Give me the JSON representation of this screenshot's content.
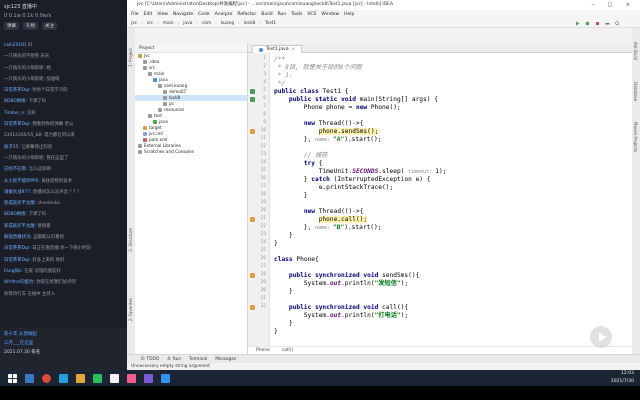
{
  "chat": {
    "header_line1": "sjc123 直播中",
    "header_line2": "0  0.1w  0.1k  0.0w/s",
    "header_buttons": [
      "弹幕",
      "礼物",
      "关注"
    ],
    "messages": [
      {
        "user": "cwh20181",
        "text": "好"
      },
      {
        "user": "",
        "text": "一只快乐的不想卷 乐乐"
      },
      {
        "user": "",
        "text": "一只快乐的小萌新呢: 她"
      },
      {
        "user": "",
        "text": "一只快乐的小萌新呢: 加油呀"
      },
      {
        "user": "日常茶茶Dqr:",
        "text": "秒杀个日常学习的"
      },
      {
        "user": "BOBO网络:",
        "text": "下课了吗"
      },
      {
        "user": "Timber_x:",
        "text": "没有"
      },
      {
        "user": "日常茶茶Dqr:",
        "text": "我看到你的弹幕 老公"
      },
      {
        "user": "",
        "text": "23414266/55_b8: 电力都在何以来"
      },
      {
        "user": "疯子25:",
        "text": "让屏幕停止的话"
      },
      {
        "user": "",
        "text": "一只快乐的小萌新呢: 我在这里了"
      },
      {
        "user": "已经不在哦:",
        "text": "怎么这样啊"
      },
      {
        "user": "从小就不能听PPS:",
        "text": "再往前移的技术"
      },
      {
        "user": "请做大战977:",
        "text": "直播间怎么没声音 ? ? ?"
      },
      {
        "user": "新成就买不太醒:",
        "text": "zhenbinko"
      },
      {
        "user": "BOBO网络:",
        "text": "下课了吗"
      },
      {
        "user": "新成就买不太醒:",
        "text": "继续看"
      },
      {
        "user": "解锁直播状况:",
        "text": "这都能认识看的"
      },
      {
        "user": "日常茶茶Dqr:",
        "text": "日正在看直播 你一下两小时前"
      },
      {
        "user": "日常茶茶Dqr:",
        "text": "好多上来的 你好"
      },
      {
        "user": "Fang骑x:",
        "text": "在家 没钱的朋友好"
      },
      {
        "user": "Wh尔cs的配为:",
        "text": "你现在给我们加点吧"
      },
      {
        "user": "",
        "text": "你等待行车 在线中 主持人"
      }
    ],
    "footer_lines": [
      "新十年 从我做起",
      "三月___在这里",
      "2021.07.30 排名"
    ]
  },
  "ide": {
    "title": "jvc [C:\\Users\\Administrator\\Desktop\\并发编程\\jvc] - ...\\src\\main\\java\\com\\kuang\\lock8\\Test1.java [jvc] - IntelliJ IDEA",
    "menu": [
      "File",
      "Edit",
      "View",
      "Navigate",
      "Code",
      "Analyze",
      "Refactor",
      "Build",
      "Run",
      "Tools",
      "VCS",
      "Window",
      "Help"
    ],
    "breadcrumbs": [
      "jvc",
      "src",
      "main",
      "java",
      "com",
      "kuang",
      "lock8",
      "Test1"
    ],
    "project_header": "Project",
    "tree": [
      {
        "label": "jvc",
        "depth": 0,
        "color": "#c7a34a",
        "selected": false
      },
      {
        "label": ".idea",
        "depth": 1,
        "color": "#9a9a9a",
        "selected": false
      },
      {
        "label": "src",
        "depth": 1,
        "color": "#9a9a9a",
        "selected": false
      },
      {
        "label": "main",
        "depth": 2,
        "color": "#9a9a9a",
        "selected": false
      },
      {
        "label": "java",
        "depth": 3,
        "color": "#4a8ed8",
        "selected": false
      },
      {
        "label": "com.kuang",
        "depth": 4,
        "color": "#9a9a9a",
        "selected": false
      },
      {
        "label": "demo07",
        "depth": 5,
        "color": "#9a9a9a",
        "selected": false
      },
      {
        "label": "lock8",
        "depth": 5,
        "color": "#9a9a9a",
        "selected": true
      },
      {
        "label": "pc",
        "depth": 5,
        "color": "#9a9a9a",
        "selected": false
      },
      {
        "label": "resources",
        "depth": 4,
        "color": "#9a9a9a",
        "selected": false
      },
      {
        "label": "test",
        "depth": 2,
        "color": "#9a9a9a",
        "selected": false
      },
      {
        "label": "java",
        "depth": 3,
        "color": "#4aa84a",
        "selected": false
      },
      {
        "label": "target",
        "depth": 1,
        "color": "#e0a040",
        "selected": false
      },
      {
        "label": "jvc.iml",
        "depth": 1,
        "color": "#8aa0c8",
        "selected": false
      },
      {
        "label": "pom.xml",
        "depth": 1,
        "color": "#d06060",
        "selected": false
      },
      {
        "label": "External Libraries",
        "depth": 0,
        "color": "#9a9a9a",
        "selected": false
      },
      {
        "label": "Scratches and Consoles",
        "depth": 0,
        "color": "#9a9a9a",
        "selected": false
      }
    ],
    "tab_label": "Test1.java",
    "line_numbers": [
      "1",
      "2",
      "3",
      "4",
      "5",
      "6",
      "7",
      "8",
      "9",
      "10",
      "11",
      "12",
      "13",
      "14",
      "15",
      "16",
      "17",
      "18",
      "19",
      "20",
      "21",
      "22",
      "23",
      "24",
      "25",
      "26",
      "27",
      "28",
      "29",
      "30",
      "31",
      "32"
    ],
    "code_footer_breadcrumb": [
      "Phone",
      "call()"
    ],
    "bottom_tools": [
      "6: TODO",
      "4: Run",
      "Terminal",
      "Messages"
    ],
    "status_text": "Unnecessary empty string argument",
    "left_strip_labels": [
      "1: Project",
      "2: Structure",
      "2: Favorites"
    ],
    "right_strip_labels": [
      "Ant Build",
      "Database",
      "Maven Projects"
    ]
  },
  "taskbar": {
    "time": "12:03",
    "date": "2021/7/30"
  },
  "colors": {
    "keyword": "#000080",
    "string": "#067d17",
    "comment": "#8c8c8c",
    "field": "#660e7a",
    "highlight": "#fff3b0"
  }
}
